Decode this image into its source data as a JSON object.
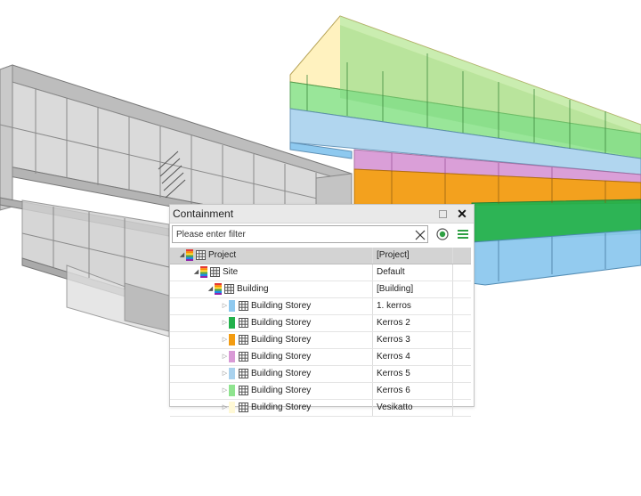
{
  "panel": {
    "title": "Containment",
    "filter_placeholder": "Please enter filter"
  },
  "tree": {
    "header": {
      "label": "Project",
      "value": "[Project]"
    },
    "rows": [
      {
        "label": "Site",
        "value": "Default",
        "depth": 1,
        "expanded": true,
        "icon": "rainbow-icon"
      },
      {
        "label": "Building",
        "value": "[Building]",
        "depth": 2,
        "expanded": true,
        "icon": "rainbow-icon"
      },
      {
        "label": "Building Storey",
        "value": "1. kerros",
        "depth": 3,
        "expanded": false,
        "color": "#8ec9ef"
      },
      {
        "label": "Building Storey",
        "value": "Kerros 2",
        "depth": 3,
        "expanded": false,
        "color": "#22b14c"
      },
      {
        "label": "Building Storey",
        "value": "Kerros 3",
        "depth": 3,
        "expanded": false,
        "color": "#f39c12"
      },
      {
        "label": "Building Storey",
        "value": "Kerros 4",
        "depth": 3,
        "expanded": false,
        "color": "#d99ad6"
      },
      {
        "label": "Building Storey",
        "value": "Kerros 5",
        "depth": 3,
        "expanded": false,
        "color": "#a9d2ee"
      },
      {
        "label": "Building Storey",
        "value": "Kerros 6",
        "depth": 3,
        "expanded": false,
        "color": "#8fe48f"
      },
      {
        "label": "Building Storey",
        "value": "Vesikatto",
        "depth": 3,
        "expanded": false,
        "color": "#fff9d6"
      }
    ]
  },
  "colors": {
    "storey_blue": "#8ec9ef",
    "storey_green": "#22b14c",
    "storey_orange": "#f39c12",
    "storey_pink": "#d99ad6",
    "storey_lightblue": "#a9d2ee",
    "storey_lightgreen": "#8fe48f",
    "roof_cream": "#fff2bf",
    "accent_green": "#2ea043"
  }
}
